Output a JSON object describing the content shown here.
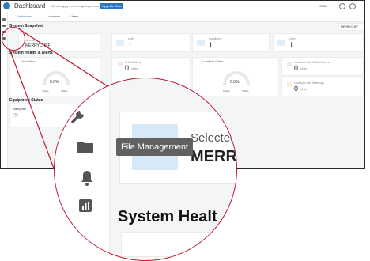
{
  "app": {
    "title": "Dashboard",
    "banner_text": "We're happy you're enjoying our new tool",
    "upgrade_label": "Upgrade Now",
    "language": "ENG"
  },
  "tabs": [
    {
      "label": "Dashboard"
    },
    {
      "label": "Locations"
    },
    {
      "label": "Users"
    }
  ],
  "snapshot": {
    "title": "System Snapshot",
    "selector_label": "Site ID",
    "selector_value": "MERRYCHEF",
    "selected_label": "Selected",
    "selected_value": "MERRYCHEF",
    "units": {
      "label": "Units",
      "value": "1"
    },
    "locations": {
      "label": "Locations",
      "value": "1"
    },
    "users": {
      "label": "Users",
      "value": "1"
    }
  },
  "health": {
    "title": "System Health & Alerts",
    "left_gauge": {
      "label": "Unit Online",
      "value": "0.0%",
      "legend_a": "Online",
      "legend_b": "Offline"
    },
    "critical": {
      "label": "Critical Alerts",
      "value": "0",
      "unit": "Units"
    },
    "center_label": "Locations Online",
    "right_gauge": {
      "label": "",
      "value": "0.0%",
      "legend_a": "Online",
      "legend_b": "Offline"
    },
    "unit_alerts": {
      "label": "Locations with Critical Errors",
      "value": "0",
      "unit": "Units"
    },
    "warnings": {
      "label": "Locations with Warnings",
      "value": "0",
      "unit": "Units"
    }
  },
  "equipment": {
    "title": "Equipment Status",
    "brand": "Merrychef",
    "count": "1"
  },
  "zoom": {
    "tooltip": "File Management",
    "selected_partial": "Selected",
    "merry_partial": "MERRY",
    "system_health_partial": "System Healt"
  },
  "colors": {
    "accent": "#2b79c2",
    "highlight": "#c0172e"
  }
}
